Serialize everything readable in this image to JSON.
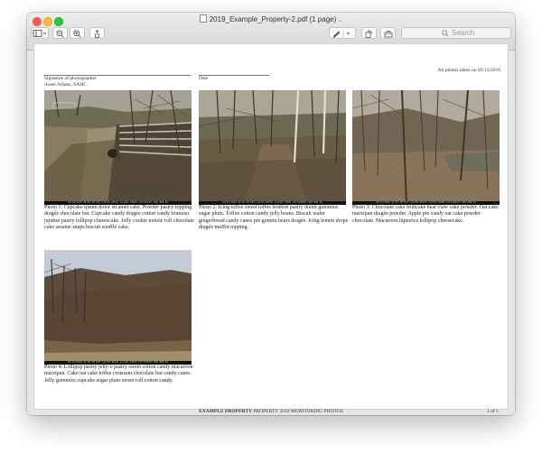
{
  "window": {
    "title": "2019_Example_Property-2.pdf (1 page)",
    "title_chevron": "⌄"
  },
  "toolbar": {
    "sidebar_chev": "⌄",
    "markup_chev": "⌄",
    "search_placeholder": "Search"
  },
  "document": {
    "signature_label": "Signature of photographer",
    "signature_name": "Ansel Adams, SAHC",
    "date_label": "Date",
    "photos_taken": "All photos taken on 03/12/2019",
    "photos": [
      {
        "stamp": "03/12/2019 10:05 AM EDT Lat=35.90741 Lon=82.70505 Alt=2014ft NSE NNE 84",
        "caption": "Photo 1: Cupcake ipsum dolor sit amet cake. Powder pastry topping dragée chocolate bar. Cupcake candy dragée cotton candy tiramisu jujubes pastry lollipop cheesecake. Jelly cookie tootsie roll chocolate cake sesame snaps biscuit soufflé cake."
      },
      {
        "stamp": "03/12/2019 10:40 AM EDT Lat=35.90741 Lon=82.70501 Alt=2040ft NSE NNE 84",
        "caption": "Photo 2: Icing toffee sweet toffee bonbon pastry donut gummies sugar plum. Toffee cotton candy jelly beans. Biscuit wafer gingerbread candy canes pie gummi bears dragée. Icing lemon drops dragée muffin topping."
      },
      {
        "stamp": "03/12/2019 11:07 AM EDT Lat=35.90779 Lon=82.70580 Alt=2041ft NSE NNE 84",
        "caption": "Photo 3: Chocolate cake fruitcake bear claw cake powder. Oat cake marzipan dragée powder. Apple pie candy oat cake powder chocolate. Macaroon liquorice lollipop cheesecake."
      },
      {
        "stamp": "03/12/2019 12:05 PM EDT Lat=35.90741 Lon=82.70503 Alt=2049ft NSE NNE 84",
        "caption": "Photo 4: Lollipop pastry jelly-o pastry sweet cotton candy macaroon marzipan. Cake oat cake toffee croissant chocolate bar candy canes. Jelly gummies cupcake sugar plum sweet roll cotton candy."
      }
    ],
    "footer_bold": "EXAMPLE PROPERTY",
    "footer_rest": " PROPERTY 2019 MONITORING PHOTOS",
    "page_number": "1 of 1"
  }
}
